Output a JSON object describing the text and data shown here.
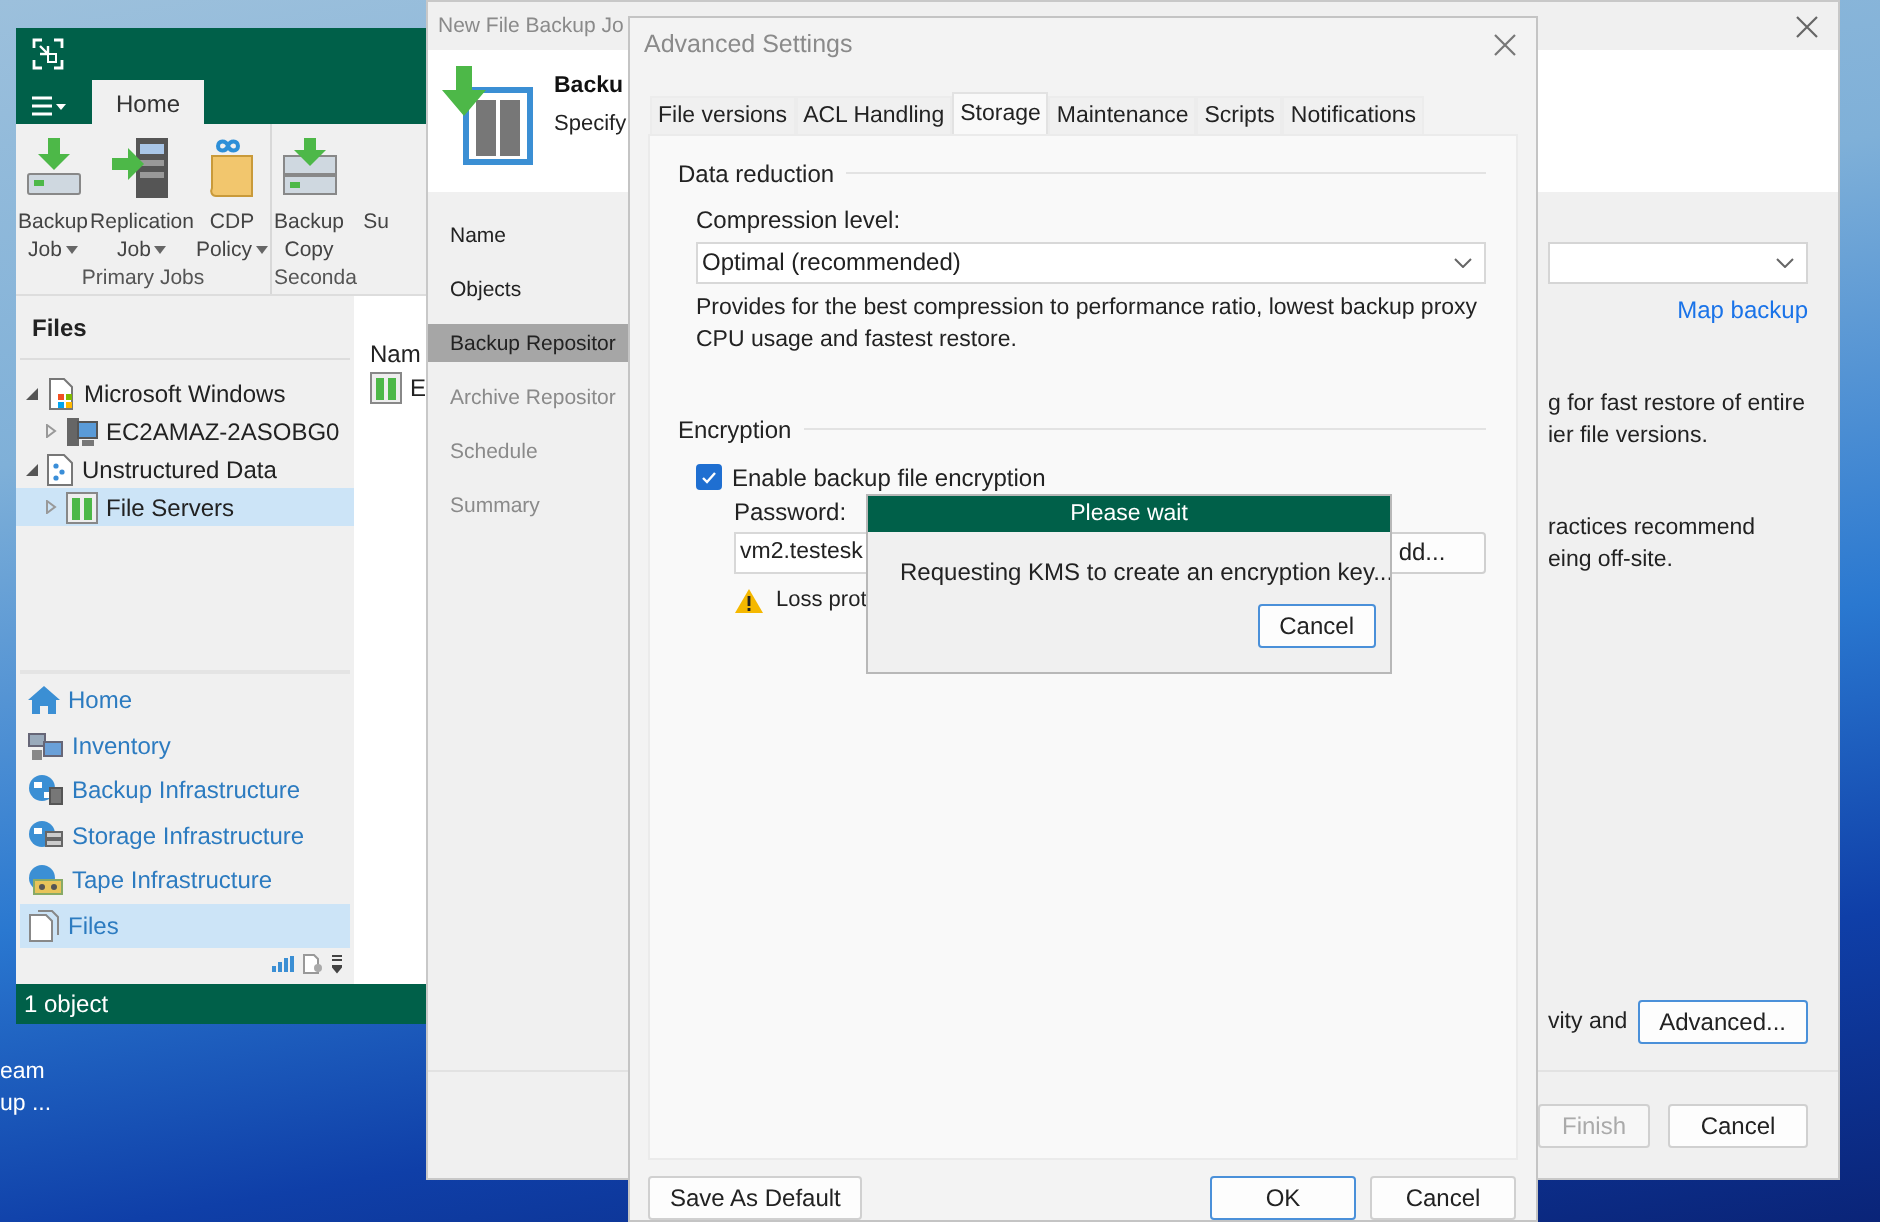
{
  "desktop": {
    "icon_labels": [
      "eam",
      "up ..."
    ]
  },
  "main_window": {
    "tabs": [
      {
        "label": "Home",
        "selected": true
      }
    ],
    "ribbon": [
      {
        "label": "Primary Jobs",
        "buttons": [
          {
            "kind": "backup",
            "line1": "Backup",
            "line2": "Job",
            "menu": true
          },
          {
            "kind": "replication",
            "line1": "Replication",
            "line2": "Job",
            "menu": true
          },
          {
            "kind": "cdp",
            "line1": "CDP",
            "line2": "Policy",
            "menu": true
          }
        ]
      },
      {
        "label": "Seconda",
        "buttons": [
          {
            "kind": "copy",
            "line1": "Backup",
            "line2": "Copy",
            "menu": false
          },
          {
            "kind": "hidden",
            "line1": "Su"
          }
        ]
      }
    ],
    "files_pane": {
      "title": "Files",
      "tree": [
        {
          "kind": "platform",
          "label": "Microsoft Windows",
          "expanded": true,
          "selected": false,
          "children": [
            {
              "kind": "server",
              "label": "EC2AMAZ-2ASOBG0",
              "expanded": false,
              "selected": false
            }
          ]
        },
        {
          "kind": "data",
          "label": "Unstructured Data",
          "expanded": true,
          "selected": false,
          "children": [
            {
              "kind": "share",
              "label": "File Servers",
              "expanded": false,
              "selected": true
            }
          ]
        }
      ]
    },
    "navigation": [
      {
        "kind": "home",
        "label": "Home",
        "selected": false
      },
      {
        "kind": "inventory",
        "label": "Inventory",
        "selected": false
      },
      {
        "kind": "backup",
        "label": "Backup Infrastructure",
        "selected": false
      },
      {
        "kind": "storage",
        "label": "Storage Infrastructure",
        "selected": false
      },
      {
        "kind": "tape",
        "label": "Tape Infrastructure",
        "selected": false
      },
      {
        "kind": "files",
        "label": "Files",
        "selected": true
      }
    ],
    "content": {
      "column_1": "Nam",
      "rows": [
        "E"
      ]
    },
    "status_bar": "1 object"
  },
  "wizard": {
    "title": "New File Backup Jo",
    "header_title": "Backu",
    "header_subtitle": "Specify",
    "steps": [
      {
        "label": "Name",
        "selected": false,
        "disabled": false
      },
      {
        "label": "Objects",
        "selected": false,
        "disabled": false
      },
      {
        "label": "Backup Repositor",
        "selected": true,
        "disabled": false
      },
      {
        "label": "Archive Repositor",
        "selected": false,
        "disabled": true
      },
      {
        "label": "Schedule",
        "selected": false,
        "disabled": true
      },
      {
        "label": "Summary",
        "selected": false,
        "disabled": true
      }
    ],
    "link": "Map backup",
    "paragraphs": [
      [
        "g for fast restore of entire",
        "ier file versions."
      ],
      [
        "ractices recommend",
        "eing off-site."
      ]
    ],
    "bottom_text": "vity and",
    "advanced_button": "Advanced...",
    "buttons": [
      {
        "label": "Finish",
        "disabled": true
      },
      {
        "label": "Cancel",
        "disabled": false
      }
    ]
  },
  "advanced_dialog": {
    "title": "Advanced Settings",
    "tabs": [
      {
        "label": "File versions",
        "selected": false
      },
      {
        "label": "ACL Handling",
        "selected": false
      },
      {
        "label": "Storage",
        "selected": true
      },
      {
        "label": "Maintenance",
        "selected": false
      },
      {
        "label": "Scripts",
        "selected": false
      },
      {
        "label": "Notifications",
        "selected": false
      }
    ],
    "data_reduction": {
      "title": "Data reduction",
      "compression_label": "Compression level:",
      "compression_value": "Optimal (recommended)",
      "description": "Provides for the best compression to performance ratio, lowest backup proxy CPU usage and fastest restore."
    },
    "encryption": {
      "title": "Encryption",
      "checkbox": {
        "label": "Enable backup file encryption",
        "checked": true
      },
      "password_label": "Password:",
      "password_value": "vm2.testesk",
      "add_button": "dd...",
      "warning": "Loss prot"
    },
    "save_default": "Save As Default",
    "ok": "OK",
    "cancel": "Cancel"
  },
  "please_wait": {
    "title": "Please wait",
    "message": "Requesting KMS to create an encryption key...",
    "cancel": "Cancel"
  }
}
